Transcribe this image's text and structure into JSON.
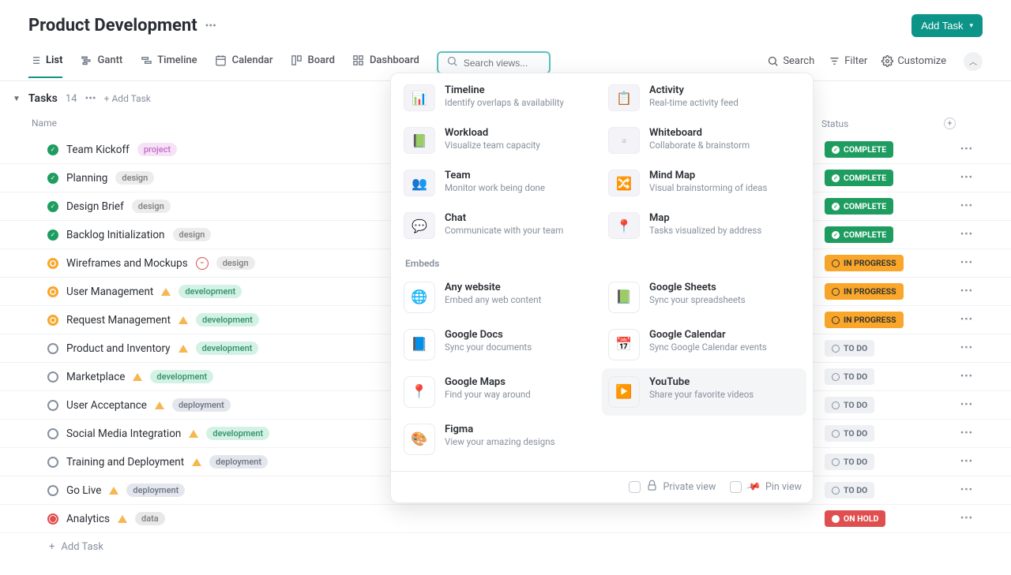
{
  "header": {
    "title": "Product Development",
    "add_task_label": "Add Task"
  },
  "tabs": {
    "list": "List",
    "gantt": "Gantt",
    "timeline": "Timeline",
    "calendar": "Calendar",
    "board": "Board",
    "dashboard": "Dashboard",
    "search_placeholder": "Search views..."
  },
  "toolbar": {
    "search": "Search",
    "filter": "Filter",
    "customize": "Customize"
  },
  "section": {
    "title": "Tasks",
    "count": "14",
    "add_task": "Add Task"
  },
  "columns": {
    "name": "Name",
    "status": "Status"
  },
  "statuses": {
    "complete": "COMPLETE",
    "in_progress": "IN PROGRESS",
    "todo": "TO DO",
    "on_hold": "ON HOLD"
  },
  "tags": {
    "project": "project",
    "design": "design",
    "development": "development",
    "deployment": "deployment",
    "data": "data"
  },
  "tasks": [
    {
      "name": "Team Kickoff",
      "status": "complete",
      "tag": "project",
      "icons": []
    },
    {
      "name": "Planning",
      "status": "complete",
      "tag": "design",
      "icons": []
    },
    {
      "name": "Design Brief",
      "status": "complete",
      "tag": "design",
      "icons": []
    },
    {
      "name": "Backlog Initialization",
      "status": "complete",
      "tag": "design",
      "icons": []
    },
    {
      "name": "Wireframes and Mockups",
      "status": "in_progress",
      "tag": "design",
      "icons": [
        "blocker"
      ]
    },
    {
      "name": "User Management",
      "status": "in_progress",
      "tag": "development",
      "icons": [
        "warn"
      ]
    },
    {
      "name": "Request Management",
      "status": "in_progress",
      "tag": "development",
      "icons": [
        "warn"
      ]
    },
    {
      "name": "Product and Inventory",
      "status": "todo",
      "tag": "development",
      "icons": [
        "warn"
      ]
    },
    {
      "name": "Marketplace",
      "status": "todo",
      "tag": "development",
      "icons": [
        "warn"
      ]
    },
    {
      "name": "User Acceptance",
      "status": "todo",
      "tag": "deployment",
      "icons": [
        "warn"
      ]
    },
    {
      "name": "Social Media Integration",
      "status": "todo",
      "tag": "development",
      "icons": [
        "warn"
      ]
    },
    {
      "name": "Training and Deployment",
      "status": "todo",
      "tag": "deployment",
      "icons": [
        "warn"
      ]
    },
    {
      "name": "Go Live",
      "status": "todo",
      "tag": "deployment",
      "icons": [
        "warn"
      ]
    },
    {
      "name": "Analytics",
      "status": "on_hold",
      "tag": "data",
      "icons": [
        "warn"
      ]
    }
  ],
  "add_task_row": "Add Task",
  "dropdown": {
    "views": [
      {
        "title": "Timeline",
        "sub": "Identify overlaps & availability",
        "icon": "📊"
      },
      {
        "title": "Activity",
        "sub": "Real-time activity feed",
        "icon": "📋"
      },
      {
        "title": "Workload",
        "sub": "Visualize team capacity",
        "icon": "📗"
      },
      {
        "title": "Whiteboard",
        "sub": "Collaborate & brainstorm",
        "icon": "▫️"
      },
      {
        "title": "Team",
        "sub": "Monitor work being done",
        "icon": "👥"
      },
      {
        "title": "Mind Map",
        "sub": "Visual brainstorming of ideas",
        "icon": "🔀"
      },
      {
        "title": "Chat",
        "sub": "Communicate with your team",
        "icon": "💬"
      },
      {
        "title": "Map",
        "sub": "Tasks visualized by address",
        "icon": "📍"
      }
    ],
    "embeds_label": "Embeds",
    "embeds": [
      {
        "title": "Any website",
        "sub": "Embed any web content",
        "icon": "🌐"
      },
      {
        "title": "Google Sheets",
        "sub": "Sync your spreadsheets",
        "icon": "📗"
      },
      {
        "title": "Google Docs",
        "sub": "Sync your documents",
        "icon": "📘"
      },
      {
        "title": "Google Calendar",
        "sub": "Sync Google Calendar events",
        "icon": "📅"
      },
      {
        "title": "Google Maps",
        "sub": "Find your way around",
        "icon": "📍"
      },
      {
        "title": "YouTube",
        "sub": "Share your favorite videos",
        "icon": "▶️",
        "hover": true
      },
      {
        "title": "Figma",
        "sub": "View your amazing designs",
        "icon": "🎨"
      }
    ],
    "footer": {
      "private": "Private view",
      "pin": "Pin view"
    }
  }
}
